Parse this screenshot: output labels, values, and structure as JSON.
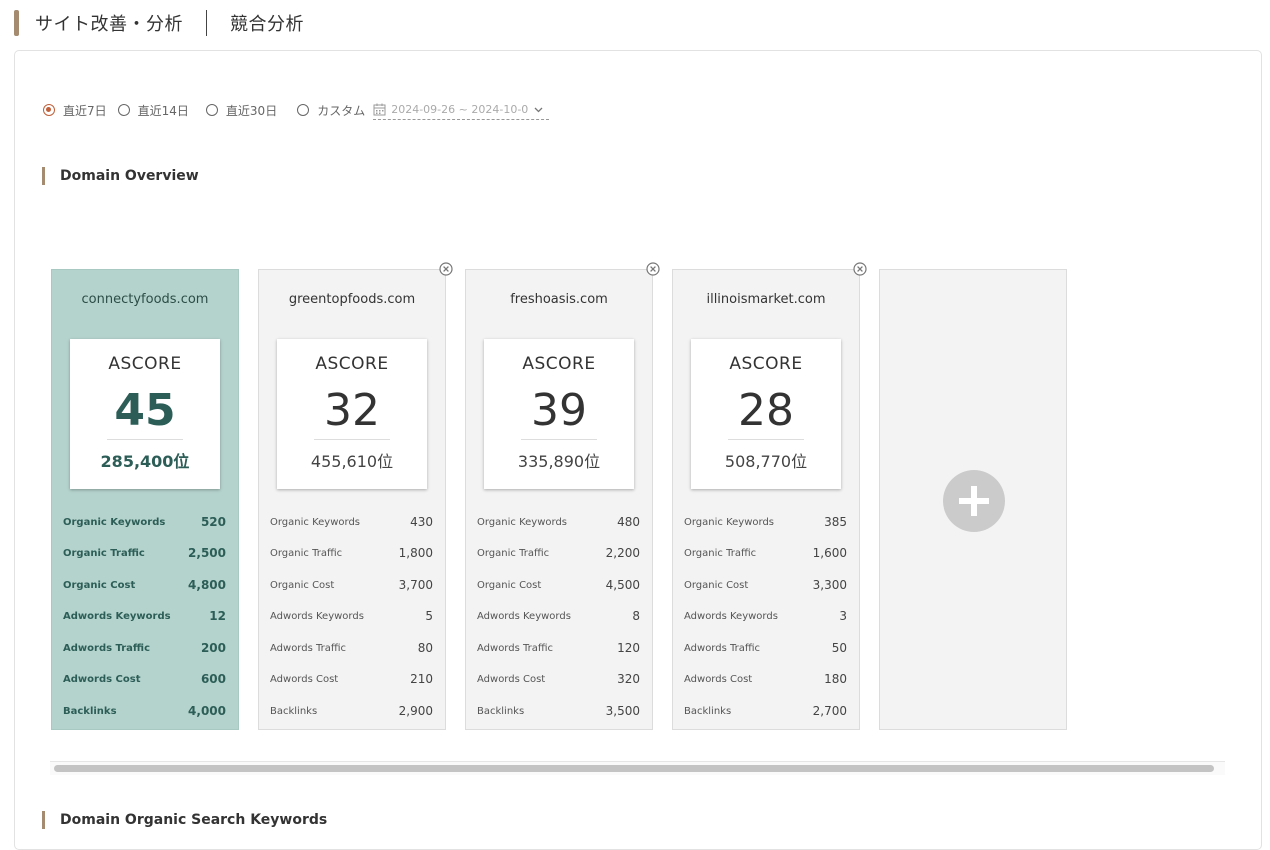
{
  "header": {
    "title": "サイト改善・分析",
    "subtitle": "競合分析"
  },
  "period": {
    "options": [
      {
        "label": "直近7日",
        "checked": true
      },
      {
        "label": "直近14日",
        "checked": false
      },
      {
        "label": "直近30日",
        "checked": false
      },
      {
        "label": "カスタム",
        "checked": false
      }
    ],
    "date_range": "2024-09-26 ~ 2024-10-0"
  },
  "sections": {
    "overview": "Domain Overview",
    "keywords": "Domain Organic Search Keywords"
  },
  "score_label": "ASCORE",
  "metric_labels": [
    "Organic Keywords",
    "Organic Traffic",
    "Organic Cost",
    "Adwords Keywords",
    "Adwords Traffic",
    "Adwords Cost",
    "Backlinks"
  ],
  "domains": [
    {
      "domain": "connectyfoods.com",
      "ascore": "45",
      "rank": "285,400位",
      "metrics": [
        "520",
        "2,500",
        "4,800",
        "12",
        "200",
        "600",
        "4,000"
      ],
      "primary": true
    },
    {
      "domain": "greentopfoods.com",
      "ascore": "32",
      "rank": "455,610位",
      "metrics": [
        "430",
        "1,800",
        "3,700",
        "5",
        "80",
        "210",
        "2,900"
      ],
      "primary": false
    },
    {
      "domain": "freshoasis.com",
      "ascore": "39",
      "rank": "335,890位",
      "metrics": [
        "480",
        "2,200",
        "4,500",
        "8",
        "120",
        "320",
        "3,500"
      ],
      "primary": false
    },
    {
      "domain": "illinoismarket.com",
      "ascore": "28",
      "rank": "508,770位",
      "metrics": [
        "385",
        "1,600",
        "3,300",
        "3",
        "50",
        "180",
        "2,700"
      ],
      "primary": false
    }
  ],
  "colors": {
    "accent": "#a58b70",
    "primary_card": "#b5d3cd",
    "primary_text": "#2c5e57",
    "radio_checked": "#c0603a"
  },
  "icons": {
    "calendar": "calendar-icon",
    "close": "close-circle-icon",
    "add": "plus-circle-icon",
    "chevron": "chevron-down-icon"
  }
}
